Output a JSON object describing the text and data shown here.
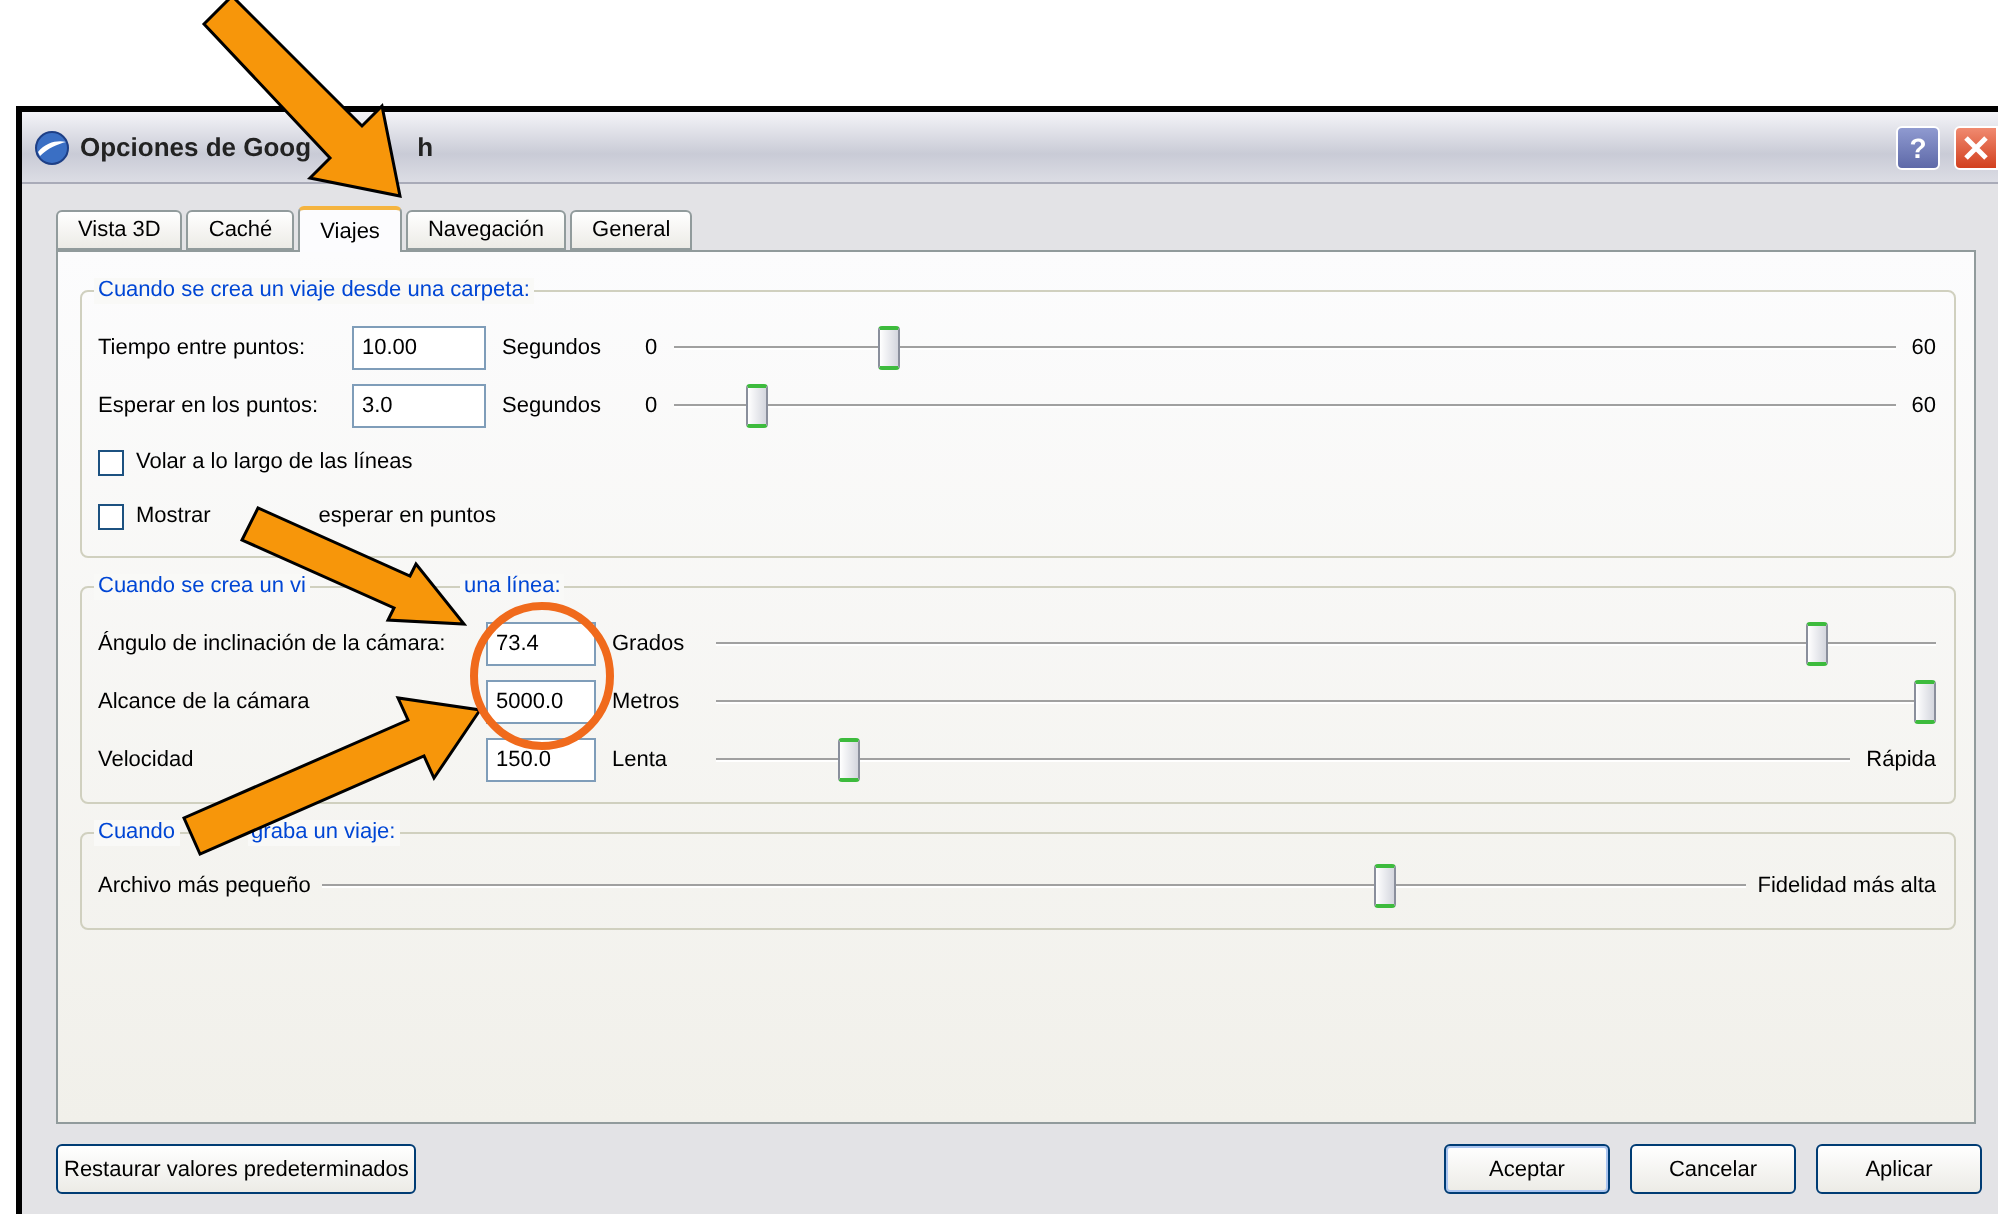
{
  "window": {
    "title_parts": [
      "Opciones de Goog",
      "h"
    ],
    "help_label": "?"
  },
  "tabs": [
    {
      "label": "Vista 3D",
      "selected": false
    },
    {
      "label": "Caché",
      "selected": false
    },
    {
      "label": "Viajes",
      "selected": true
    },
    {
      "label": "Navegación",
      "selected": false
    },
    {
      "label": "General",
      "selected": false
    }
  ],
  "groups": [
    {
      "title_parts": [
        "Cuando se crea un viaje desde una carpeta:"
      ],
      "rows": [
        {
          "kind": "slider",
          "label_parts": [
            "Tiempo entre puntos:"
          ],
          "value": "10.00",
          "unit": "Segundos",
          "min_label": "0",
          "max_label": "60",
          "level": 0.17
        },
        {
          "kind": "slider",
          "label_parts": [
            "Esperar en los puntos:"
          ],
          "value": "3.0",
          "unit": "Segundos",
          "min_label": "0",
          "max_label": "60",
          "level": 0.06
        },
        {
          "kind": "checkbox",
          "label_parts": [
            "Volar a lo largo de las líneas"
          ],
          "checked": false
        },
        {
          "kind": "checkbox",
          "label_parts": [
            "Mostrar",
            "esperar en puntos"
          ],
          "checked": false
        }
      ]
    },
    {
      "title_parts": [
        "Cuando se crea un vi",
        "una línea:"
      ],
      "rows": [
        {
          "kind": "slider",
          "label_parts": [
            "Ángulo de inclinación de la cámara:"
          ],
          "value": "73.4",
          "unit": "Grados",
          "level": 0.91
        },
        {
          "kind": "slider",
          "label_parts": [
            "Alcance de la cámara"
          ],
          "value": "5000.0",
          "unit": "Metros",
          "level": 1.0
        },
        {
          "kind": "slider",
          "label_parts": [
            "Velocidad"
          ],
          "value": "150.0",
          "unit": "Lenta",
          "max_label": "Rápida",
          "level": 0.11
        }
      ]
    },
    {
      "title_parts": [
        "Cuando",
        "graba un viaje:"
      ],
      "rows": [
        {
          "kind": "range",
          "min_label": "Archivo más pequeño",
          "max_label": "Fidelidad más alta",
          "level": 0.75
        }
      ]
    }
  ],
  "buttons": [
    {
      "label": "Restaurar valores predeterminados",
      "kind": "left"
    },
    {
      "label": "Aceptar",
      "kind": "default"
    },
    {
      "label": "Cancelar",
      "kind": "normal"
    },
    {
      "label": "Aplicar",
      "kind": "normal"
    }
  ]
}
